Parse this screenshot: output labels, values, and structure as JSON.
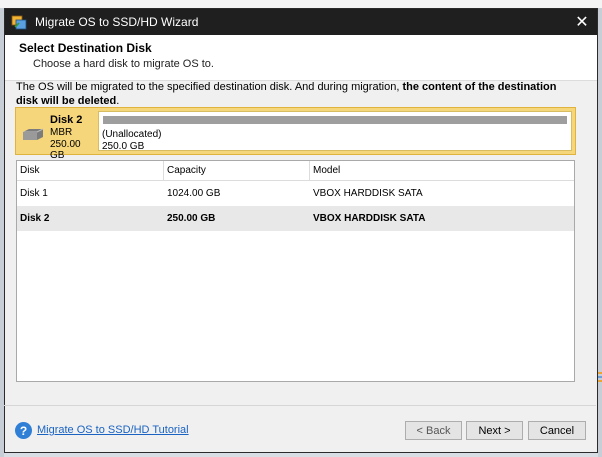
{
  "window": {
    "title": "Migrate OS to SSD/HD Wizard",
    "close_glyph": "✕"
  },
  "header": {
    "title": "Select Destination Disk",
    "subtitle": "Choose a hard disk to migrate OS to."
  },
  "description": {
    "normal": "The OS will be migrated to the specified destination disk. And during migration, ",
    "bold": "the content of the destination disk will be deleted",
    "end": "."
  },
  "selected_disk": {
    "name": "Disk 2",
    "type": "MBR",
    "size": "250.00 GB",
    "partition_label": "(Unallocated)",
    "partition_size": "250.0 GB"
  },
  "table": {
    "headers": [
      "Disk",
      "Capacity",
      "Model"
    ],
    "rows": [
      {
        "disk": "Disk 1",
        "capacity": "1024.00 GB",
        "model": "VBOX HARDDISK SATA"
      },
      {
        "disk": "Disk 2",
        "capacity": "250.00 GB",
        "model": "VBOX HARDDISK SATA"
      }
    ]
  },
  "footer": {
    "help_glyph": "?",
    "tutorial_link": "Migrate OS to SSD/HD Tutorial",
    "back_label": "< Back",
    "next_label": "Next >",
    "cancel_label": "Cancel"
  },
  "icons": {
    "app": "migrate-app-icon",
    "disk": "hard-disk-icon",
    "help": "help-icon",
    "close": "close-icon"
  },
  "colors": {
    "selected_card": "#f6d67a",
    "link": "#1a63c2",
    "titlebar": "#1f1f1f",
    "help_icon": "#2f7fd6"
  }
}
